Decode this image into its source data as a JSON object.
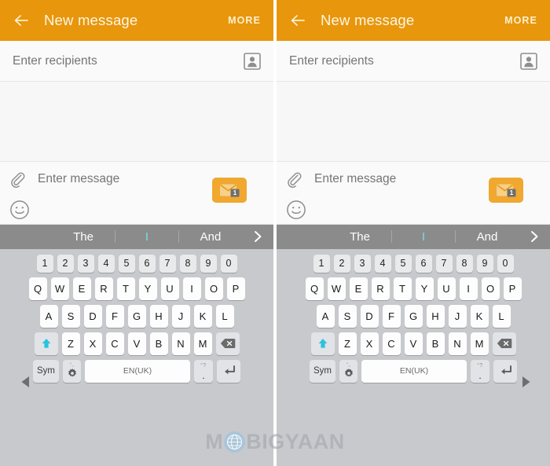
{
  "meta": {
    "platform": "Samsung Android Messages - New message composer",
    "panels": 2,
    "watermark": {
      "prefix": "M",
      "suffix": "BIGYAAN",
      "full": "MOBIGYAAN"
    }
  },
  "colors": {
    "appbar_orange": "#e8960c",
    "appbar_title": "#fdf6e4",
    "send_button": "#f0a830",
    "suggestion_bar": "#8b8b8b",
    "suggestion_accent": "#7fdbe8",
    "keyboard_bg": "#c8c9cc",
    "key_white": "#fdfdfd",
    "key_grey": "#e9eaec",
    "shift_arrow": "#29c4de",
    "placeholder_text": "#9b9b9b"
  },
  "appbar": {
    "back_label": "back-arrow",
    "title": "New message",
    "more_label": "MORE"
  },
  "recipients": {
    "placeholder": "Enter recipients",
    "value": "",
    "contact_icon": "contact-picker-icon"
  },
  "compose": {
    "attach_icon": "paperclip-icon",
    "placeholder": "Enter message",
    "value": "",
    "emoji_icon": "smiley-icon",
    "send": {
      "icon": "envelope-icon",
      "badge": "1"
    }
  },
  "suggestions": {
    "items": [
      {
        "label": "The",
        "accent": false
      },
      {
        "label": "I",
        "accent": true
      },
      {
        "label": "And",
        "accent": false
      }
    ],
    "expand_icon": "chevron-right-icon"
  },
  "keyboard": {
    "number_row": [
      "1",
      "2",
      "3",
      "4",
      "5",
      "6",
      "7",
      "8",
      "9",
      "0"
    ],
    "row1": [
      "Q",
      "W",
      "E",
      "R",
      "T",
      "Y",
      "U",
      "I",
      "O",
      "P"
    ],
    "row2": [
      "A",
      "S",
      "D",
      "F",
      "G",
      "H",
      "J",
      "K",
      "L"
    ],
    "row3": [
      "Z",
      "X",
      "C",
      "V",
      "B",
      "N",
      "M"
    ],
    "shift_key": {
      "name": "shift-key",
      "icon": "arrow-up-icon"
    },
    "backspace_key": {
      "name": "backspace-key",
      "icon": "backspace-icon"
    },
    "sym_key": {
      "label": "Sym"
    },
    "settings_key": {
      "name": "keyboard-settings-key",
      "icon": "gear-icon",
      "hint": "“„"
    },
    "space_key": {
      "label": "EN(UK)"
    },
    "punct_key": {
      "hint": "“?",
      "label": "."
    },
    "enter_key": {
      "name": "enter-key",
      "icon": "return-arrow-icon"
    }
  },
  "navigation": {
    "prev_icon": "triangle-left-icon",
    "next_icon": "triangle-right-icon"
  }
}
